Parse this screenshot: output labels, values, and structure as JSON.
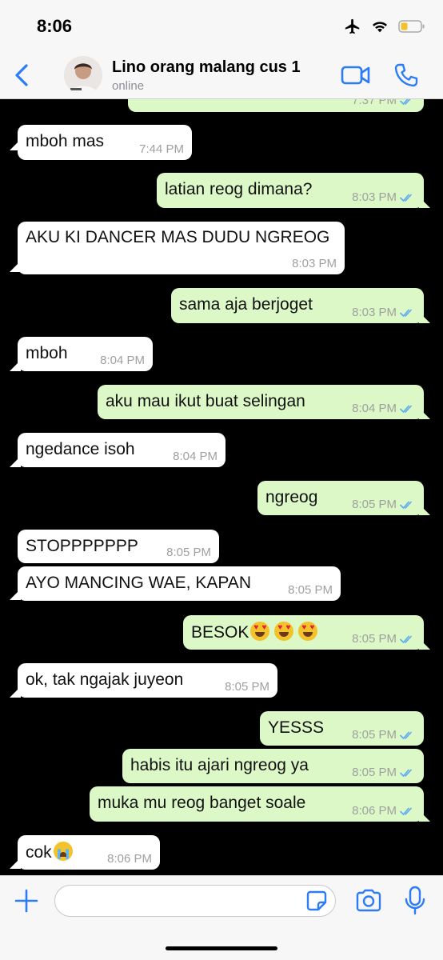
{
  "status_bar": {
    "time": "8:06",
    "icons": [
      "airplane-icon",
      "wifi-icon",
      "battery-icon"
    ]
  },
  "header": {
    "contact_name": "Lino orang malang cus 1",
    "contact_status": "online",
    "icons": [
      "back-chevron-icon",
      "video-call-icon",
      "phone-icon"
    ]
  },
  "messages": [
    {
      "dir": "out",
      "text": "",
      "time": "7:37 PM",
      "read": true
    },
    {
      "dir": "in",
      "text": "mboh mas",
      "time": "7:44 PM"
    },
    {
      "dir": "out",
      "text": "latian reog dimana?",
      "time": "8:03 PM",
      "read": true
    },
    {
      "dir": "in",
      "text": "AKU KI DANCER MAS DUDU NGREOG",
      "time": "8:03 PM"
    },
    {
      "dir": "out",
      "text": "sama aja berjoget",
      "time": "8:03 PM",
      "read": true
    },
    {
      "dir": "in",
      "text": "mboh",
      "time": "8:04 PM"
    },
    {
      "dir": "out",
      "text": "aku mau ikut buat selingan",
      "time": "8:04 PM",
      "read": true
    },
    {
      "dir": "in",
      "text": "ngedance isoh",
      "time": "8:04 PM"
    },
    {
      "dir": "out",
      "text": "ngreog",
      "time": "8:05 PM",
      "read": true
    },
    {
      "dir": "in",
      "text": "STOPPPPPPP",
      "time": "8:05 PM"
    },
    {
      "dir": "in",
      "text": "AYO MANCING WAE, KAPAN",
      "time": "8:05 PM"
    },
    {
      "dir": "out",
      "text": "BESOK",
      "emoji": "heart-eyes-emoji x3",
      "time": "8:05 PM",
      "read": true
    },
    {
      "dir": "in",
      "text": "ok, tak ngajak juyeon",
      "time": "8:05 PM"
    },
    {
      "dir": "out",
      "text": "YESSS",
      "time": "8:05 PM",
      "read": true
    },
    {
      "dir": "out",
      "text": "habis itu ajari ngreog ya",
      "time": "8:05 PM",
      "read": true
    },
    {
      "dir": "out",
      "text": "muka mu reog banget soale",
      "time": "8:06 PM",
      "read": true
    },
    {
      "dir": "in",
      "text": "cok",
      "emoji": "crying-emoji",
      "time": "8:06 PM"
    }
  ],
  "input_bar": {
    "placeholder": "",
    "icons": [
      "plus-icon",
      "sticker-icon",
      "camera-icon",
      "microphone-icon"
    ]
  },
  "colors": {
    "chat_background": "#000000",
    "incoming_bubble": "#ffffff",
    "outgoing_bubble": "#dbf8c6",
    "accent_blue": "#2b7cf6",
    "read_ticks": "#5aa9f5"
  }
}
